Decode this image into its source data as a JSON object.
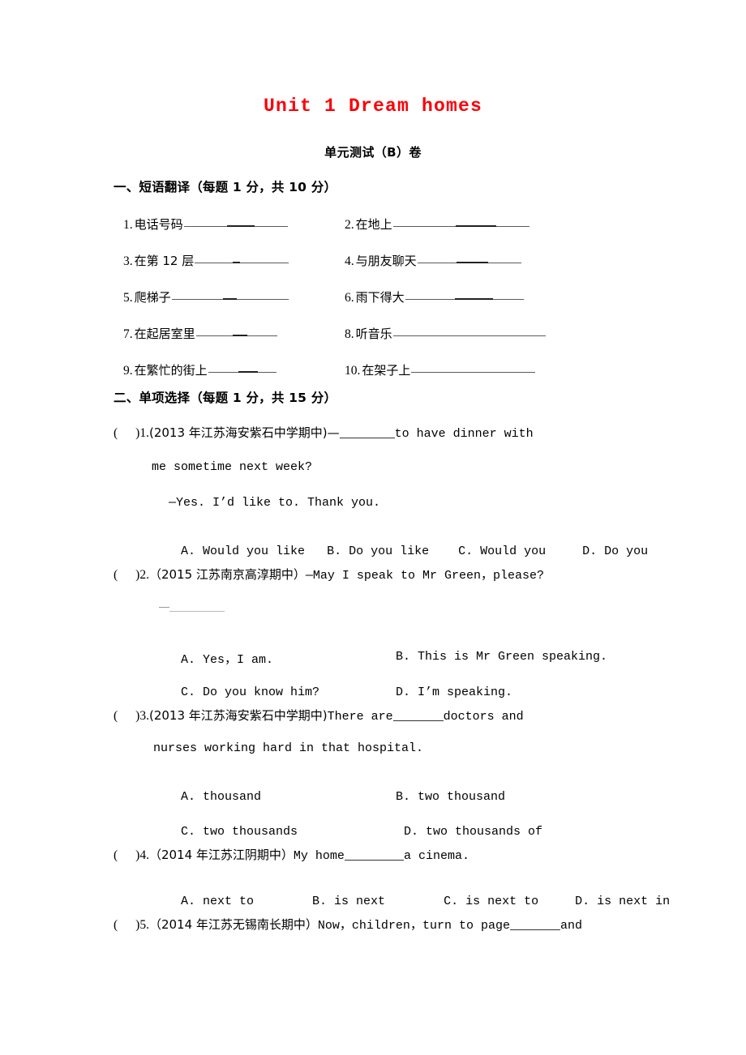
{
  "document": {
    "title": "Unit 1 Dream homes",
    "subtitle": "单元测试（B）卷",
    "title_color": "#fb0007"
  },
  "section1": {
    "heading": "一、短语翻译（每题 1 分，共 10 分）",
    "items": [
      {
        "num": "1.",
        "label": "电话号码"
      },
      {
        "num": "2.",
        "label": "在地上"
      },
      {
        "num": "3.",
        "label": "在第 12 层"
      },
      {
        "num": "4.",
        "label": "与朋友聊天"
      },
      {
        "num": "5.",
        "label": "爬梯子"
      },
      {
        "num": "6.",
        "label": "雨下得大"
      },
      {
        "num": "7.",
        "label": "在起居室里"
      },
      {
        "num": "8.",
        "label": "听音乐"
      },
      {
        "num": "9.",
        "label": "在繁忙的街上"
      },
      {
        "num": "10.",
        "label": "在架子上"
      }
    ]
  },
  "section2": {
    "heading": "二、单项选择（每题 1 分，共 15 分）",
    "questions": [
      {
        "bracket": "(",
        "bracket_close": ")",
        "num": "1.",
        "source": "(2013 年江苏海安紫石中学期中)",
        "stem_pre": "—",
        "stem_post": "to have dinner with",
        "stem_line2": "me sometime next week?",
        "stem_line3": "—Yes. I’d like to. Thank you.",
        "options": [
          "A. Would you like",
          "B. Do you like",
          "C. Would you",
          "D. Do you"
        ]
      },
      {
        "bracket": "(",
        "bracket_close": ")",
        "num": "2.",
        "source": "（2015 江苏南京高淳期中）",
        "stem_pre": "—May I speak to Mr Green，please?",
        "stem_line2": "—",
        "options": [
          "A. Yes，I am.",
          "B. This is Mr Green speaking.",
          "C. Do you know him?",
          "D. I’m speaking."
        ]
      },
      {
        "bracket": "(",
        "bracket_close": ")",
        "num": "3.",
        "source": "(2013 年江苏海安紫石中学期中)",
        "stem_pre": "There are",
        "stem_post": "doctors and",
        "stem_line2": "nurses working hard in that hospital.",
        "options": [
          "A. thousand",
          "B. two thousand",
          "C. two thousands",
          "D. two thousands of"
        ]
      },
      {
        "bracket": "(",
        "bracket_close": ")",
        "num": "4.",
        "source": "（2014 年江苏江阴期中）",
        "stem_pre": "My home",
        "stem_post": "a cinema.",
        "options": [
          "A. next to",
          "B. is next",
          "C. is next to",
          "D. is next in"
        ]
      },
      {
        "bracket": "(",
        "bracket_close": ")",
        "num": "5.",
        "source": "（2014 年江苏无锡南长期中）",
        "stem_pre": "Now，children，turn to page",
        "stem_post": "and",
        "options": []
      }
    ]
  }
}
